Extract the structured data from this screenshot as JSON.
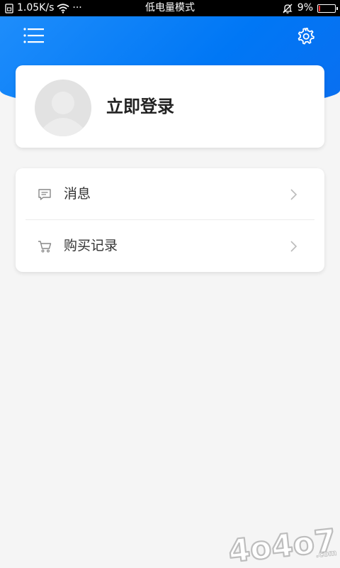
{
  "status_bar": {
    "speed": "1.05K/s",
    "dots": "···",
    "mode": "低电量模式",
    "battery_percent": "9%",
    "battery_level": 0.09
  },
  "profile": {
    "login_label": "立即登录"
  },
  "menu": {
    "items": [
      {
        "label": "消息",
        "icon": "message-icon"
      },
      {
        "label": "购买记录",
        "icon": "cart-icon"
      }
    ]
  },
  "colors": {
    "header_blue": "#0a7ef7",
    "background": "#f5f5f5",
    "card": "#ffffff",
    "battery_low": "#ff2a2a"
  },
  "watermark": {
    "text": "4o4o7",
    "suffix": ".com"
  }
}
